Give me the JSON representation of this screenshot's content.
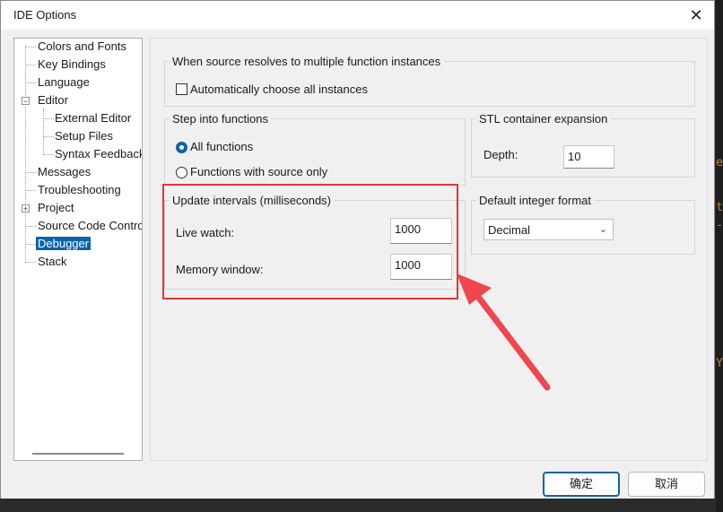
{
  "window": {
    "title": "IDE Options"
  },
  "tree": {
    "items": [
      {
        "label": "Colors and Fonts"
      },
      {
        "label": "Key Bindings"
      },
      {
        "label": "Language"
      },
      {
        "label": "Editor",
        "expander": "−"
      },
      {
        "label": "External Editor"
      },
      {
        "label": "Setup Files"
      },
      {
        "label": "Syntax Feedback"
      },
      {
        "label": "Messages"
      },
      {
        "label": "Troubleshooting"
      },
      {
        "label": "Project",
        "expander": "+"
      },
      {
        "label": "Source Code Control"
      },
      {
        "label": "Debugger",
        "selected": true
      },
      {
        "label": "Stack"
      }
    ]
  },
  "multi_instance": {
    "legend": "When source resolves to multiple function instances",
    "auto_choose_label": "Automatically choose all instances",
    "auto_choose_checked": false
  },
  "step_into": {
    "legend": "Step into functions",
    "options": [
      "All functions",
      "Functions with source only"
    ],
    "selected": "All functions"
  },
  "stl": {
    "legend": "STL container expansion",
    "depth_label": "Depth:",
    "depth_value": "10"
  },
  "update_intervals": {
    "legend": "Update intervals (milliseconds)",
    "live_watch_label": "Live watch:",
    "live_watch_value": "1000",
    "memory_window_label": "Memory window:",
    "memory_window_value": "1000"
  },
  "integer_format": {
    "legend": "Default integer format",
    "selected": "Decimal"
  },
  "buttons": {
    "ok": "确定",
    "cancel": "取消"
  },
  "background_glyphs": [
    "e",
    "t",
    "-",
    "Y"
  ],
  "colors": {
    "accent": "#0a64ad",
    "highlight": "#e8323a"
  }
}
